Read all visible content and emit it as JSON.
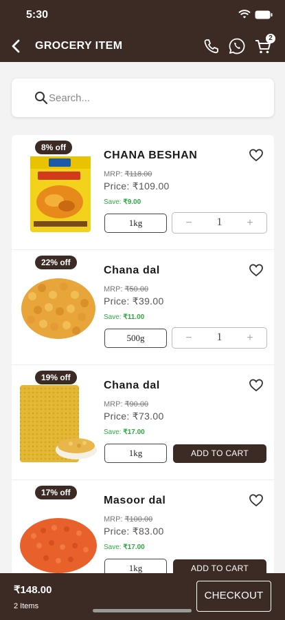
{
  "status_bar": {
    "time": "5:30"
  },
  "header": {
    "title": "GROCERY ITEM",
    "cart_count": "2",
    "icons": [
      "back-icon",
      "phone-icon",
      "whatsapp-icon",
      "cart-icon"
    ]
  },
  "search": {
    "placeholder": "Search..."
  },
  "products": [
    {
      "discount": "8% off",
      "name": "CHANA BESHAN",
      "mrp_label": "MRP:",
      "mrp": "₹118.00",
      "price_label": "Price:",
      "price": "₹109.00",
      "save_label": "Save:",
      "save": "₹9.00",
      "unit": "1kg",
      "qty": "1",
      "qty_minus": "−",
      "qty_plus": "+"
    },
    {
      "discount": "22% off",
      "name": "Chana dal",
      "mrp_label": "MRP:",
      "mrp": "₹50.00",
      "price_label": "Price:",
      "price": "₹39.00",
      "save_label": "Save:",
      "save": "₹11.00",
      "unit": "500g",
      "qty": "1",
      "qty_minus": "−",
      "qty_plus": "+"
    },
    {
      "discount": "19% off",
      "name": "Chana dal",
      "mrp_label": "MRP:",
      "mrp": "₹90.00",
      "price_label": "Price:",
      "price": "₹73.00",
      "save_label": "Save:",
      "save": "₹17.00",
      "unit": "1kg",
      "button": "ADD TO CART"
    },
    {
      "discount": "17% off",
      "name": "Masoor dal",
      "mrp_label": "MRP:",
      "mrp": "₹100.00",
      "price_label": "Price:",
      "price": "₹83.00",
      "save_label": "Save:",
      "save": "₹17.00",
      "unit": "1kg",
      "button": "ADD TO CART"
    }
  ],
  "footer": {
    "total": "₹148.00",
    "items": "2 Items",
    "checkout": "CHECKOUT"
  },
  "colors": {
    "brand": "#3c2b24",
    "save_green": "#2fa843"
  }
}
